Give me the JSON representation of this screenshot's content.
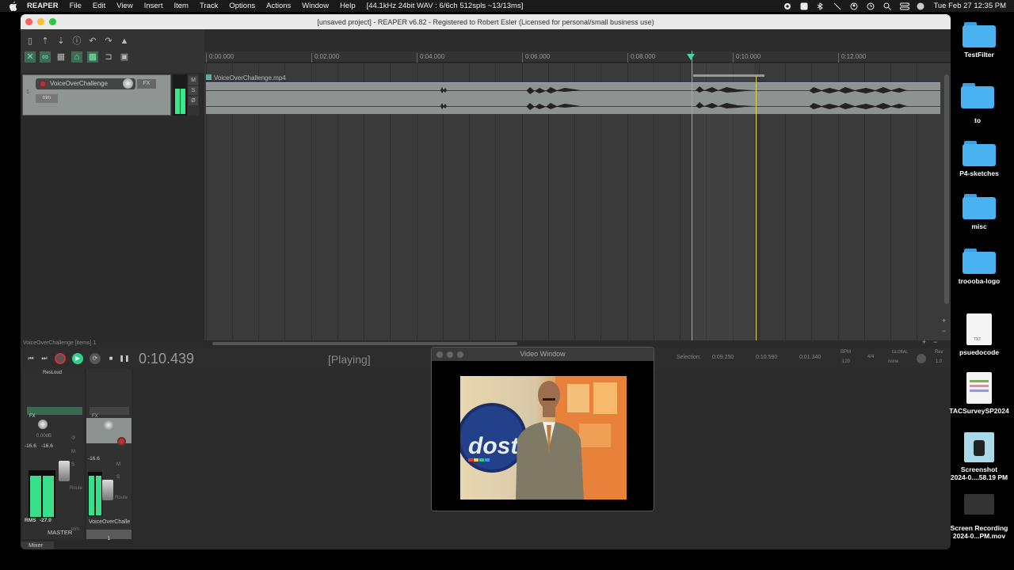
{
  "menubar": {
    "app": "REAPER",
    "items": [
      "File",
      "Edit",
      "View",
      "Insert",
      "Item",
      "Track",
      "Options",
      "Actions",
      "Window",
      "Help"
    ],
    "audio_status": "[44.1kHz 24bit WAV : 6/6ch 512spls ~13/13ms]",
    "clock": "Tue Feb 27  12:35 PM"
  },
  "window": {
    "title": "[unsaved project] - REAPER v6.82 - Registered to Robert Esler (Licensed for personal/small business use)"
  },
  "ruler": {
    "ticks": [
      "0:00.000",
      "0:02.000",
      "0:04.000",
      "0:06.000",
      "0:08.000",
      "0:10.000",
      "0:12.000"
    ]
  },
  "track": {
    "name": "VoiceOverChallenge",
    "fx_label": "FX",
    "trim_label": "trim",
    "msr": [
      "M",
      "S",
      "Ø"
    ]
  },
  "item": {
    "label": "VoiceOverChallenge.mp4"
  },
  "status": {
    "items_line": "VoiceOverChallenge [items] 1"
  },
  "transport": {
    "time": "0:10.439",
    "state": "[Playing]",
    "selection_label": "Selection:",
    "sel_start": "0:09.250",
    "sel_end": "0:10.590",
    "sel_len": "0:01.340",
    "bpm_label": "BPM",
    "bpm": "120",
    "timesig": "4/4",
    "global_label": "GLOBAL",
    "global_value": "none",
    "rev_label": "Rev",
    "rev_value": "1.0"
  },
  "mixer": {
    "master_header": "ResLoud",
    "fx_label": "FX",
    "master_db": "0.00dB",
    "master_peak_l": "-16.6",
    "master_peak_r": "-16.6",
    "rms_label": "RMS",
    "rms_value": "-27.0",
    "route_label": "Route",
    "trim_label": "trim",
    "master_name": "MASTER",
    "track_peak": "-16.6",
    "track_num": "1",
    "track_name": "VoiceOverChalle",
    "tab": "Mixer"
  },
  "video_window": {
    "title": "Video Window"
  },
  "desktop": {
    "icons": [
      {
        "label": "TestFilter",
        "kind": "folder"
      },
      {
        "label": "to",
        "kind": "folder"
      },
      {
        "label": "P4-sketches",
        "kind": "folder"
      },
      {
        "label": "misc",
        "kind": "folder"
      },
      {
        "label": "troooba-logo",
        "kind": "folder"
      },
      {
        "label": "psuedocode",
        "kind": "txt"
      },
      {
        "label": "TACSurveySP2024",
        "kind": "doc"
      },
      {
        "label": "Screenshot\n2024-0....58.19 PM",
        "kind": "image"
      },
      {
        "label": "Screen Recording\n2024-0...PM.mov",
        "kind": "video"
      }
    ]
  },
  "colors": {
    "accent_green": "#3de58b",
    "playhead": "#3ed7a8",
    "edit_cursor": "#d8d85a",
    "rec_red": "#b33333",
    "folder_blue": "#4bb2f2"
  }
}
